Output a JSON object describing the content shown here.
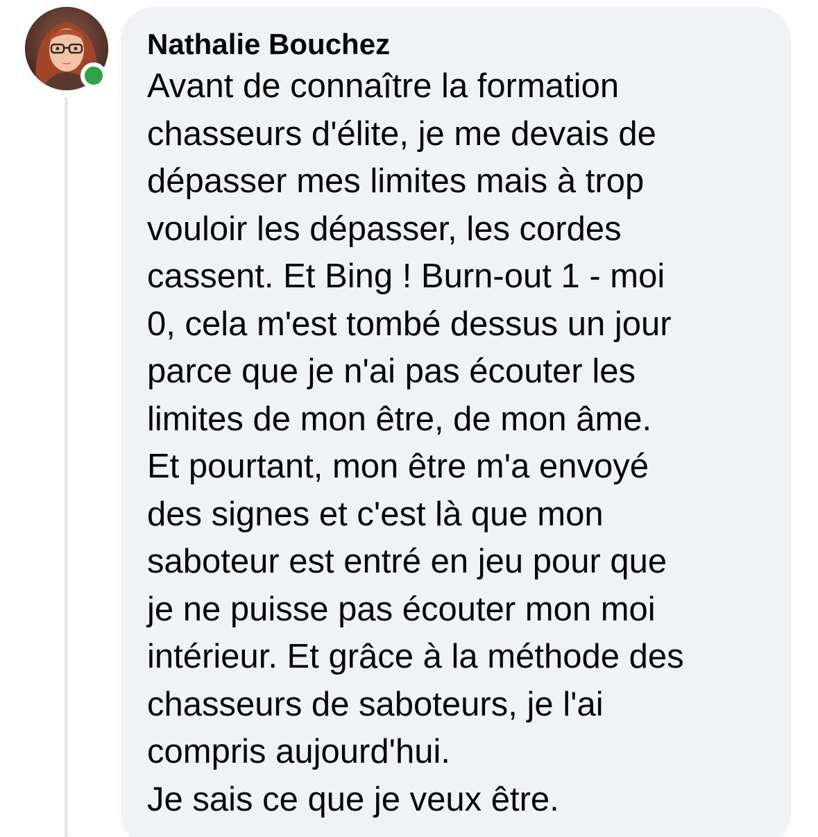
{
  "comment": {
    "author": "Nathalie Bouchez",
    "lines": [
      "Avant de connaître la formation",
      "chasseurs d'élite, je me devais de",
      "dépasser mes limites mais à trop",
      "vouloir les dépasser, les cordes",
      "cassent. Et Bing ! Burn-out 1 - moi",
      "0, cela m'est tombé dessus un jour",
      "parce que je n'ai pas écouter les",
      "limites de mon être, de mon âme.",
      "Et pourtant, mon être m'a envoyé",
      "des signes et c'est là que mon",
      "saboteur est entré en jeu pour que",
      "je ne puisse pas écouter mon moi",
      "intérieur. Et grâce à la méthode des",
      "chasseurs de saboteurs, je l'ai",
      "compris aujourd'hui.",
      "Je sais ce que je veux être."
    ]
  },
  "avatar": {
    "online_status_color": "#31a24c"
  },
  "colors": {
    "bubble_background": "#f0f2f5",
    "text": "#050505",
    "thread_line": "#e4e6eb"
  }
}
